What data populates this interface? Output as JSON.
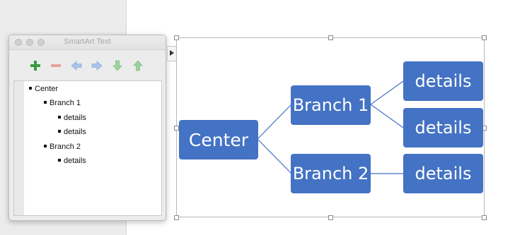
{
  "panel": {
    "title": "SmartArt Text",
    "toolbar": {
      "add_icon": "plus-icon",
      "remove_icon": "minus-icon",
      "promote_icon": "arrow-left-icon",
      "demote_icon": "arrow-right-icon",
      "move_down_icon": "arrow-down-icon",
      "move_up_icon": "arrow-up-icon",
      "colors": {
        "add": "#3c9a3c",
        "remove": "#e8a0a0",
        "indent": "#a9c4e8",
        "move": "#9fd09f"
      }
    },
    "outline": [
      {
        "label": "Center",
        "level": 0
      },
      {
        "label": "Branch 1",
        "level": 1
      },
      {
        "label": "details",
        "level": 2
      },
      {
        "label": "details",
        "level": 2
      },
      {
        "label": "Branch 2",
        "level": 1
      },
      {
        "label": "details",
        "level": 2
      }
    ]
  },
  "diagram": {
    "fill_color": "#4472c4",
    "text_color": "#ffffff",
    "line_color": "#4472c4",
    "nodes": {
      "center": "Center",
      "branch1": "Branch 1",
      "branch2": "Branch 2",
      "detail1": "details",
      "detail2": "details",
      "detail3": "details"
    }
  }
}
